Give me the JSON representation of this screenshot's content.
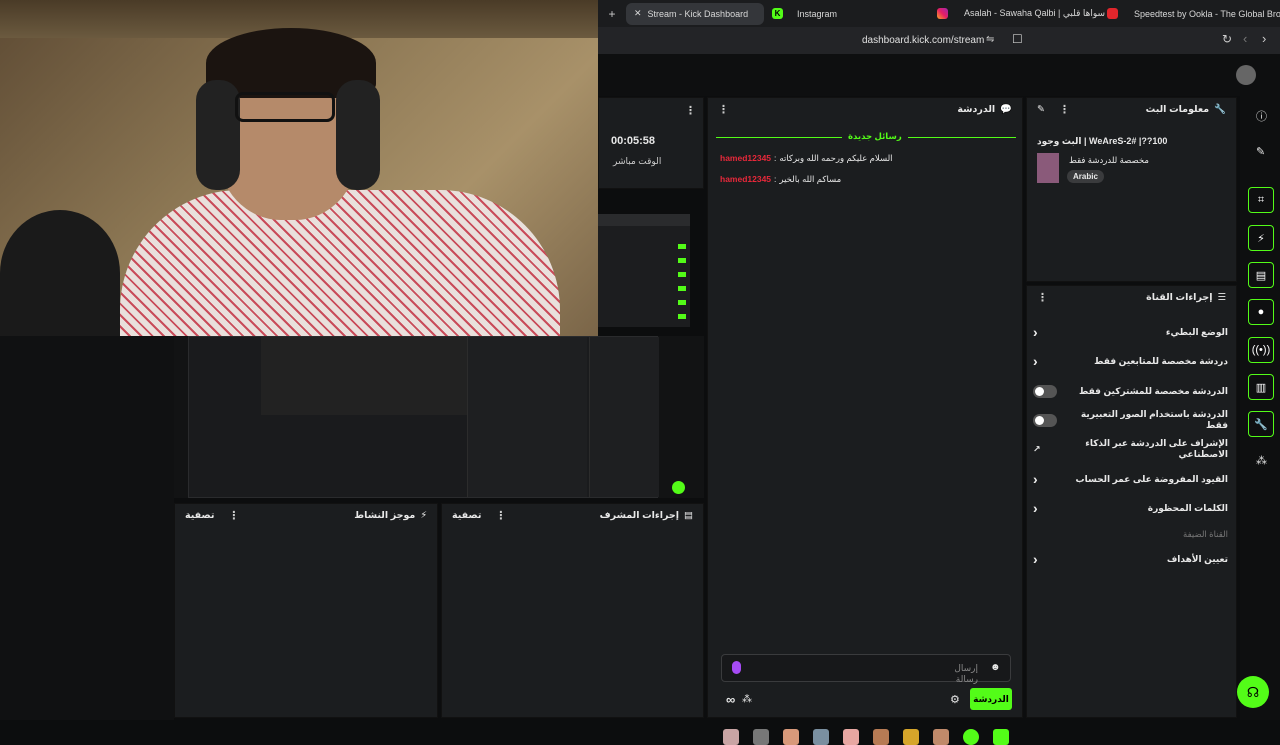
{
  "browser": {
    "tabs": [
      {
        "label": "Stream - Kick Dashboard",
        "active": true
      },
      {
        "label": "Instagram",
        "active": false
      },
      {
        "label": "Asalah - Sawaha Qalbi | سواها قلبي",
        "active": false
      },
      {
        "label": "Speedtest by Ookla - The Global Bro",
        "active": false
      }
    ],
    "url": "dashboard.kick.com/stream"
  },
  "stream_stats": {
    "uptime": "00:05:58",
    "uptime_label": "الوقت مباشر"
  },
  "chat": {
    "title": "الدردشة",
    "new_messages_label": "رسائل جديدة",
    "messages": [
      {
        "user": "hamed12345",
        "text": "السلام عليكم ورحمه الله وبركاته"
      },
      {
        "user": "hamed12345",
        "text": "مساكم الله بالخير"
      }
    ],
    "input_placeholder": "إرسال رسالة",
    "send_button": "الدردشة"
  },
  "stream_info": {
    "title": "معلومات البث",
    "stream_title": "البث وجود | WeAreS-2# |??100",
    "category": "مخصصة للدردشة فقط",
    "language_badge": "Arabic"
  },
  "channel_actions": {
    "title": "إجراءات القناة",
    "items": [
      {
        "label": "الوضع البطيء",
        "control": "chevron"
      },
      {
        "label": "دردشة مخصصة للمتابعين فقط",
        "control": "chevron"
      },
      {
        "label": "الدردشة مخصصة للمشتركين فقط",
        "control": "toggle"
      },
      {
        "label": "الدردشة باستخدام الصور التعبيرية فقط",
        "control": "toggle"
      },
      {
        "label": "الإشراف على الدردشة عبر الذكاء الاصطناعي",
        "control": "external"
      },
      {
        "label": "القيود المفروضة على عمر الحساب",
        "control": "chevron"
      },
      {
        "label": "الكلمات المحظورة",
        "control": "chevron"
      }
    ],
    "guest_channel": "القناة الضيفة",
    "targets": "تعيين الأهداف"
  },
  "bottom_panels": {
    "activity": {
      "title": "موجز النشاط",
      "filter": "تصفية"
    },
    "moderator": {
      "title": "إجراءات المشرف",
      "filter": "تصفية"
    }
  },
  "colors": {
    "accent": "#53fc18",
    "username": "#e8283a",
    "panel": "#1b1d1f"
  }
}
